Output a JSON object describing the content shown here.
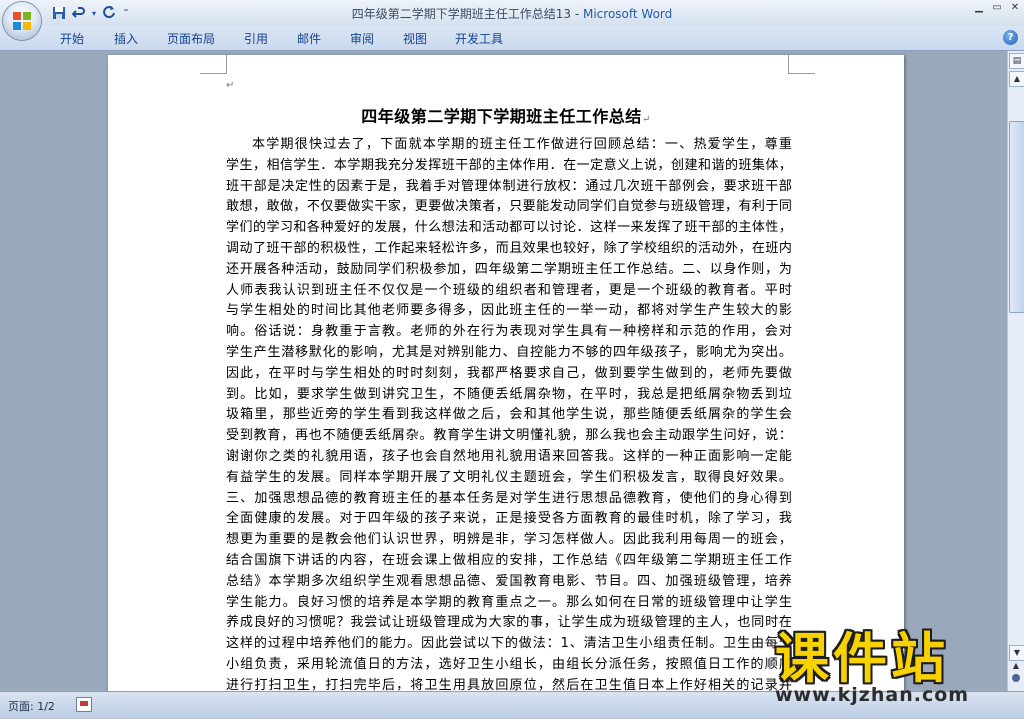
{
  "window": {
    "doc_name": "四年级第二学期下学期班主任工作总结13",
    "separator": " - ",
    "app_name": "Microsoft Word",
    "controls": [
      "▁",
      "▭",
      "✕"
    ]
  },
  "quick_access": {
    "save": "save-icon",
    "undo": "undo-icon",
    "redo": "redo-icon",
    "customize": "customize-icon"
  },
  "ribbon": {
    "tabs": [
      "开始",
      "插入",
      "页面布局",
      "引用",
      "邮件",
      "审阅",
      "视图",
      "开发工具"
    ],
    "help": "?"
  },
  "document": {
    "title": "四年级第二学期下学期班主任工作总结",
    "lines": [
      "本学期很快过去了，下面就本学期的班主任工作做进行回顾总结：一、热爱学生，尊重",
      "学生，相信学生．本学期我充分发挥班干部的主体作用．在一定意义上说，创建和谐的班集体，",
      "班干部是决定性的因素于是，我着手对管理体制进行放权：通过几次班干部例会，要求班干部",
      "敢想，敢做，不仅要做实干家，更要做决策者，只要能发动同学们自觉参与班级管理，有利于同",
      "学们的学习和各种爱好的发展，什么想法和活动都可以讨论．这样一来发挥了班干部的主体性，",
      "调动了班干部的积极性，工作起来轻松许多，而且效果也较好，除了学校组织的活动外，在班内",
      "还开展各种活动，鼓励同学们积极参加，四年级第二学期班主任工作总结。二、以身作则，为",
      "人师表我认识到班主任不仅仅是一个班级的组织者和管理者，更是一个班级的教育者。平时",
      "与学生相处的时间比其他老师要多得多，因此班主任的一举一动，都将对学生产生较大的影",
      "响。俗话说：身教重于言教。老师的外在行为表现对学生具有一种榜样和示范的作用，会对",
      "学生产生潜移默化的影响，尤其是对辨别能力、自控能力不够的四年级孩子，影响尤为突出。",
      "因此，在平时与学生相处的时时刻刻，我都严格要求自己，做到要学生做到的，老师先要做",
      "到。比如，要求学生做到讲究卫生，不随便丢纸屑杂物，在平时，我总是把纸屑杂物丢到垃",
      "圾箱里，那些近旁的学生看到我这样做之后，会和其他学生说，那些随便丢纸屑杂的学生会",
      "受到教育，再也不随便丢纸屑杂。教育学生讲文明懂礼貌，那么我也会主动跟学生问好，说：",
      "谢谢你之类的礼貌用语，孩子也会自然地用礼貌用语来回答我。这样的一种正面影响一定能",
      "有益学生的发展。同样本学期开展了文明礼仪主题班会，学生们积极发言，取得良好效果。",
      "三、加强思想品德的教育班主任的基本任务是对学生进行思想品德教育，使他们的身心得到",
      "全面健康的发展。对于四年级的孩子来说，正是接受各方面教育的最佳时机，除了学习，我",
      "想更为重要的是教会他们认识世界，明辨是非，学习怎样做人。因此我利用每周一的班会，",
      "结合国旗下讲话的内容，在班会课上做相应的安排，工作总结《四年级第二学期班主任工作",
      "总结》本学期多次组织学生观看思想品德、爱国教育电影、节目。四、加强班级管理，培养",
      "学生能力。良好习惯的培养是本学期的教育重点之一。那么如何在日常的班级管理中让学生",
      "养成良好的习惯呢？我尝试让班级管理成为大家的事，让学生成为班级管理的主人，也同时在",
      "这样的过程中培养他们的能力。因此尝试以下的做法：1、清洁卫生小组责任制。卫生由每个",
      "小组负责，采用轮流值日的方法，选好卫生小组长，由组长分派任务，按照值日工作的顺序",
      "进行打扫卫生，打扫完毕后，将卫生用具放回原位，然后在卫生值日本上作好相关的记录并"
    ]
  },
  "status": {
    "page": "页面: 1/2",
    "proofing": "proofing-icon"
  },
  "watermark": {
    "main": "课件站",
    "url": "www.kjzhan.com"
  },
  "colors": {
    "app_name": "#1f5ea8",
    "ribbon_text": "#15428b",
    "workspace": "#9aa8bb",
    "watermark_fill": "#f7d200"
  }
}
